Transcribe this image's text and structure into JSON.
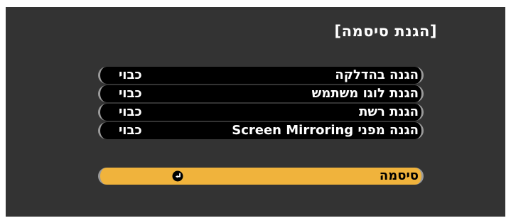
{
  "screen": {
    "title": "[הגנת סיסמה]"
  },
  "menu": {
    "items": [
      {
        "label": "הגנה בהדלקה",
        "value": "כבוי"
      },
      {
        "label": "הגנת לוגו משתמש",
        "value": "כבוי"
      },
      {
        "label": "הגנת רשת",
        "value": "כבוי"
      },
      {
        "label": "הגנה מפני Screen Mirroring",
        "value": "כבוי"
      }
    ]
  },
  "password": {
    "label": "סיסמה",
    "icon": "enter-icon"
  },
  "colors": {
    "background": "#333333",
    "row_background": "#000000",
    "highlight": "#f0b33c",
    "text": "#ffffff"
  }
}
